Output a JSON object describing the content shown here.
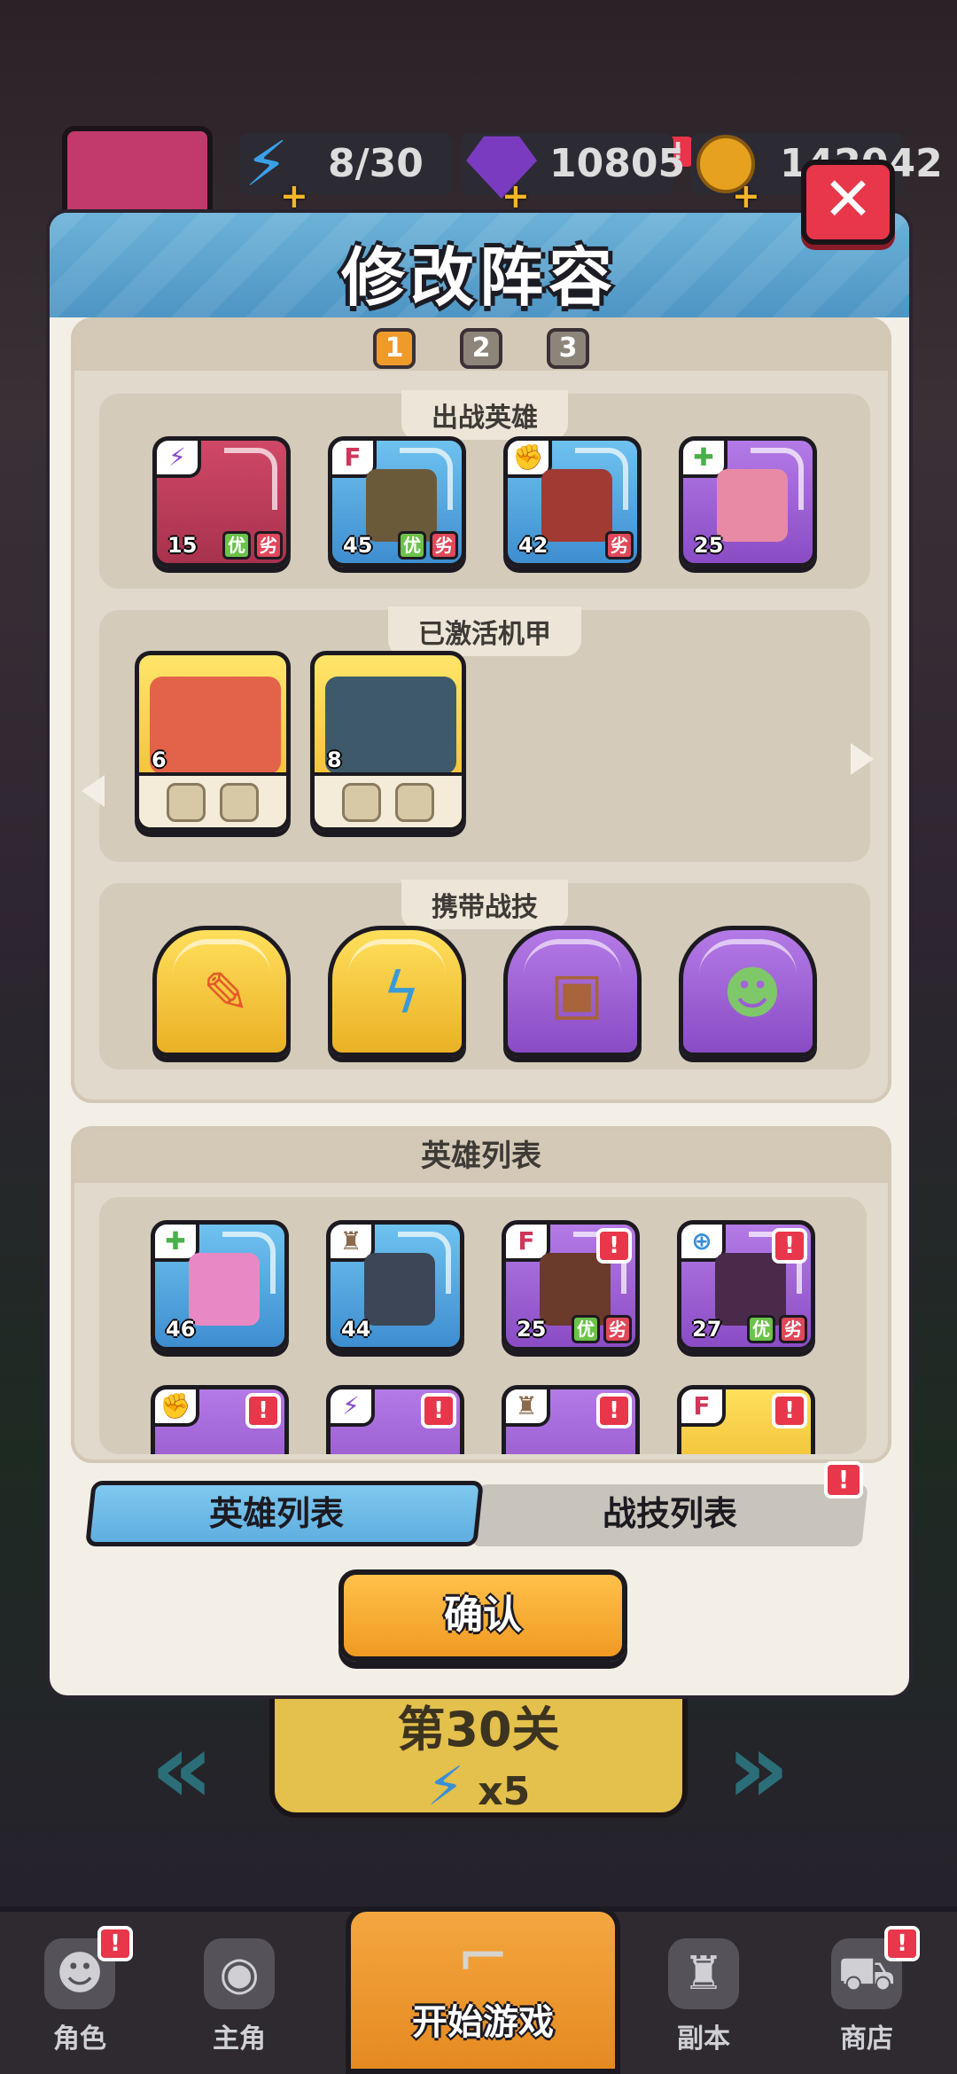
{
  "resources": {
    "energy": "8/30",
    "gems": "10805",
    "gold": "142042",
    "energy_alert": "!"
  },
  "modal": {
    "title": "修改阵容",
    "close_label": "✕",
    "lineup_tabs": [
      "1",
      "2",
      "3"
    ],
    "sections": {
      "heroes": "出战英雄",
      "mechs": "已激活机甲",
      "skills": "携带战技"
    },
    "tag_good": "优",
    "tag_bad": "劣",
    "alert": "!",
    "hero_levels": [
      "15",
      "45",
      "42",
      "25"
    ],
    "mech_levels": [
      "6",
      "8"
    ],
    "hero_list_title": "英雄列表",
    "hero_list_levels": [
      "46",
      "44",
      "25",
      "27"
    ],
    "toggle_heroes": "英雄列表",
    "toggle_skills": "战技列表",
    "confirm": "确认"
  },
  "stage": {
    "title": "第30关",
    "cost": "x5"
  },
  "nav": {
    "roles": "角色",
    "protagonist": "主角",
    "start": "开始游戏",
    "dungeon": "副本",
    "shop": "商店"
  },
  "icons": [
    "lightning-icon",
    "gem-icon",
    "coin-icon",
    "close-icon",
    "sword-icon",
    "heal-icon",
    "fist-icon",
    "fire-icon",
    "rook-icon",
    "target-icon",
    "pencil-skill-icon",
    "bolt-skill-icon",
    "shield-skill-icon",
    "zombie-skill-icon",
    "home-icon",
    "cart-icon",
    "castle-icon"
  ]
}
